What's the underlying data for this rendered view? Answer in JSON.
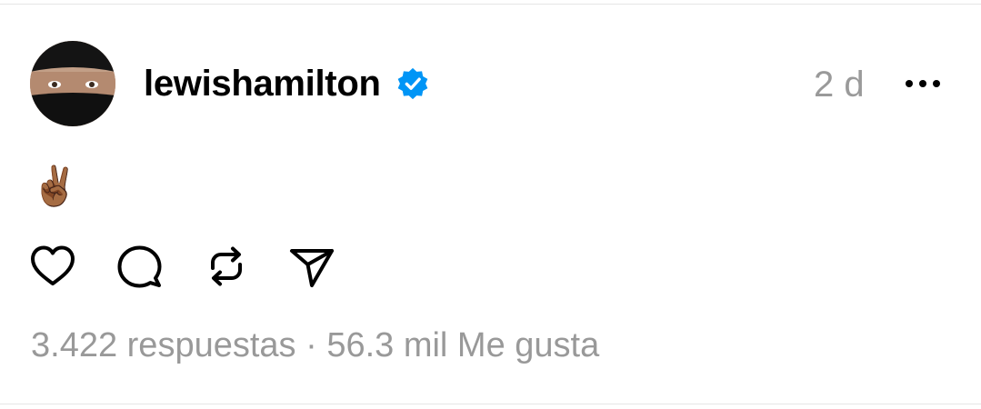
{
  "post": {
    "username": "lewishamilton",
    "time": "2 d",
    "text": "✌🏾"
  },
  "stats": {
    "replies": "3.422 respuestas",
    "separator": " · ",
    "likes": "56.3 mil Me gusta"
  },
  "icons": {
    "verified": "verified-badge-icon",
    "more": "more-options-icon",
    "like": "heart-icon",
    "reply": "comment-icon",
    "repost": "repost-icon",
    "share": "send-icon"
  },
  "colors": {
    "verified": "#0095f6",
    "text": "#000000",
    "muted": "#999999"
  }
}
